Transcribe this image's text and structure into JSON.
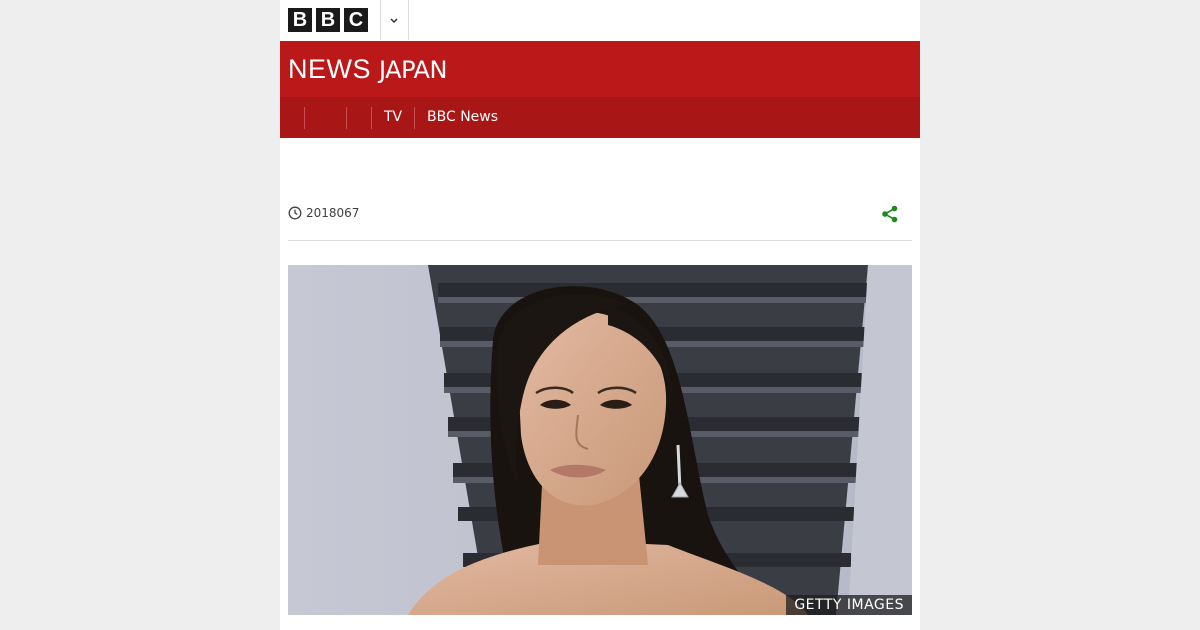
{
  "header": {
    "logo_letters": [
      "B",
      "B",
      "C"
    ],
    "menu_toggle_icon": "chevron-down-icon"
  },
  "masthead": {
    "title_main": "NEWS",
    "title_sub": "JAPAN",
    "background": "#bb1919"
  },
  "nav": {
    "items": [
      {
        "label": "TV"
      },
      {
        "label": "BBC News"
      }
    ],
    "background": "#a81616"
  },
  "article": {
    "date": "2018067",
    "date_icon": "clock-icon",
    "share_icon": "share-icon",
    "share_color": "#1c8a1c"
  },
  "hero_image": {
    "credit": "GETTY IMAGES"
  }
}
